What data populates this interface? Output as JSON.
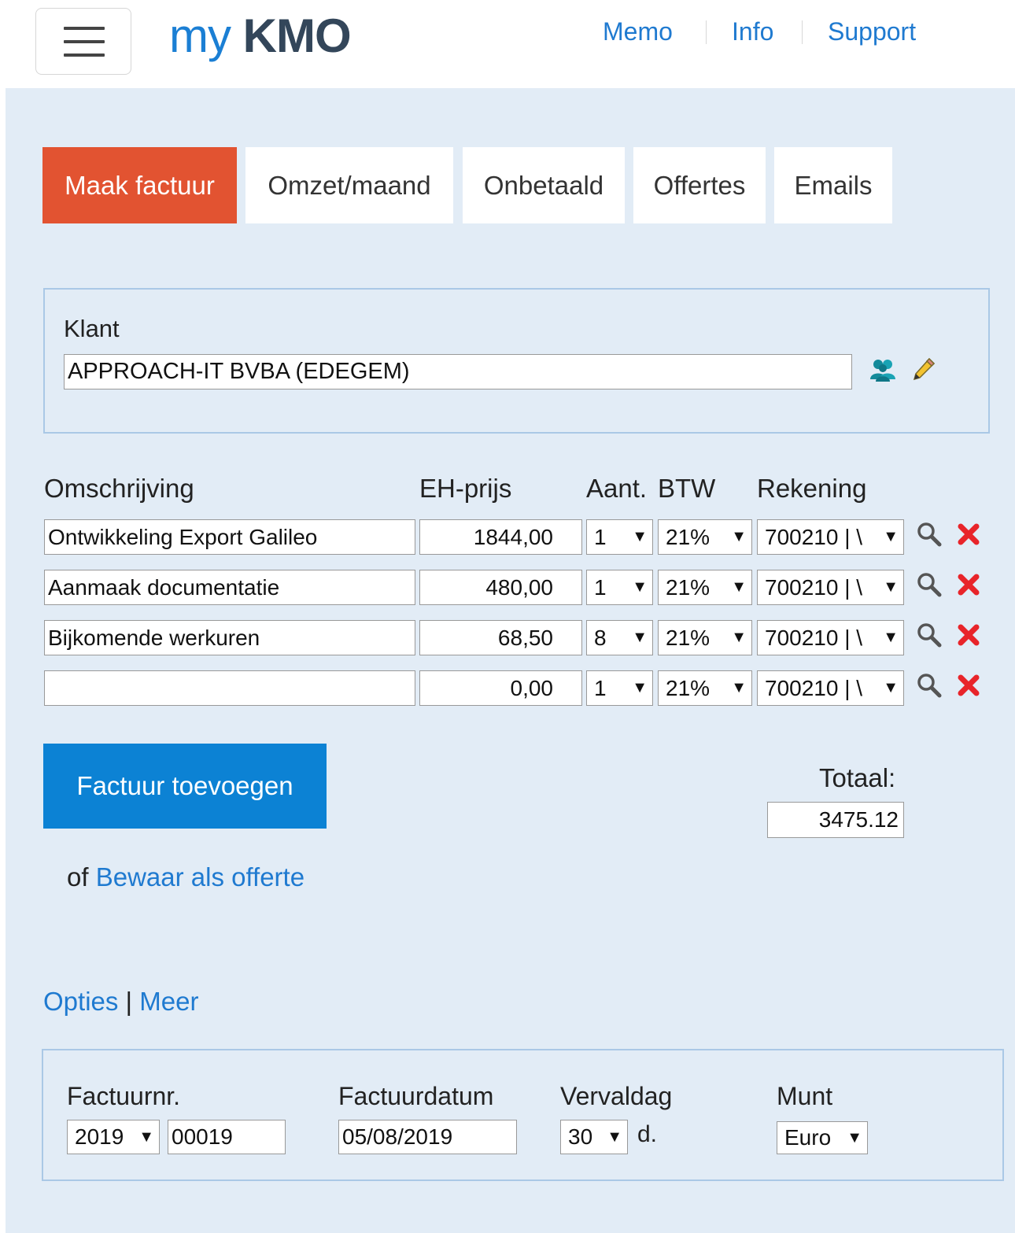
{
  "header": {
    "logo_prefix": "my",
    "logo_name": "KMO",
    "nav": [
      "Memo",
      "Info",
      "Support"
    ]
  },
  "tabs": [
    "Maak factuur",
    "Omzet/maand",
    "Onbetaald",
    "Offertes",
    "Emails"
  ],
  "active_tab": "Maak factuur",
  "klant": {
    "label": "Klant",
    "value": "APPROACH-IT BVBA (EDEGEM)",
    "icons": [
      "users-icon",
      "pencil-icon"
    ]
  },
  "lines": {
    "headers": {
      "omschrijving": "Omschrijving",
      "eh_prijs": "EH-prijs",
      "aant": "Aant.",
      "btw": "BTW",
      "rekening": "Rekening"
    },
    "rows": [
      {
        "omschrijving": "Ontwikkeling Export Galileo",
        "eh_prijs": "1844,00",
        "aant": "1",
        "btw": "21%",
        "rekening": "700210 | \\"
      },
      {
        "omschrijving": "Aanmaak documentatie",
        "eh_prijs": "480,00",
        "aant": "1",
        "btw": "21%",
        "rekening": "700210 | \\"
      },
      {
        "omschrijving": "Bijkomende werkuren",
        "eh_prijs": "68,50",
        "aant": "8",
        "btw": "21%",
        "rekening": "700210 | \\"
      },
      {
        "omschrijving": "",
        "eh_prijs": "0,00",
        "aant": "1",
        "btw": "21%",
        "rekening": "700210 | \\"
      }
    ],
    "row_icons": [
      "search-icon",
      "delete-icon"
    ]
  },
  "actions": {
    "add_button": "Factuur toevoegen",
    "or_text": "of",
    "save_offer_link": "Bewaar als offerte"
  },
  "totaal": {
    "label": "Totaal:",
    "value": "3475.12"
  },
  "options_links": {
    "opties": "Opties",
    "separator": "|",
    "meer": "Meer"
  },
  "options": {
    "factuurnr_label": "Factuurnr.",
    "factuurnr_year": "2019",
    "factuurnr_number": "00019",
    "factuurdatum_label": "Factuurdatum",
    "factuurdatum_value": "05/08/2019",
    "vervaldag_label": "Vervaldag",
    "vervaldag_value": "30",
    "vervaldag_unit": "d.",
    "munt_label": "Munt",
    "munt_value": "Euro"
  },
  "colors": {
    "brand_blue": "#1b7fd4",
    "logo_dark": "#33465a",
    "active_tab": "#e25331",
    "primary_button": "#0c82d4",
    "page_background": "#e2ecf6",
    "delete_red": "#e8242a"
  }
}
